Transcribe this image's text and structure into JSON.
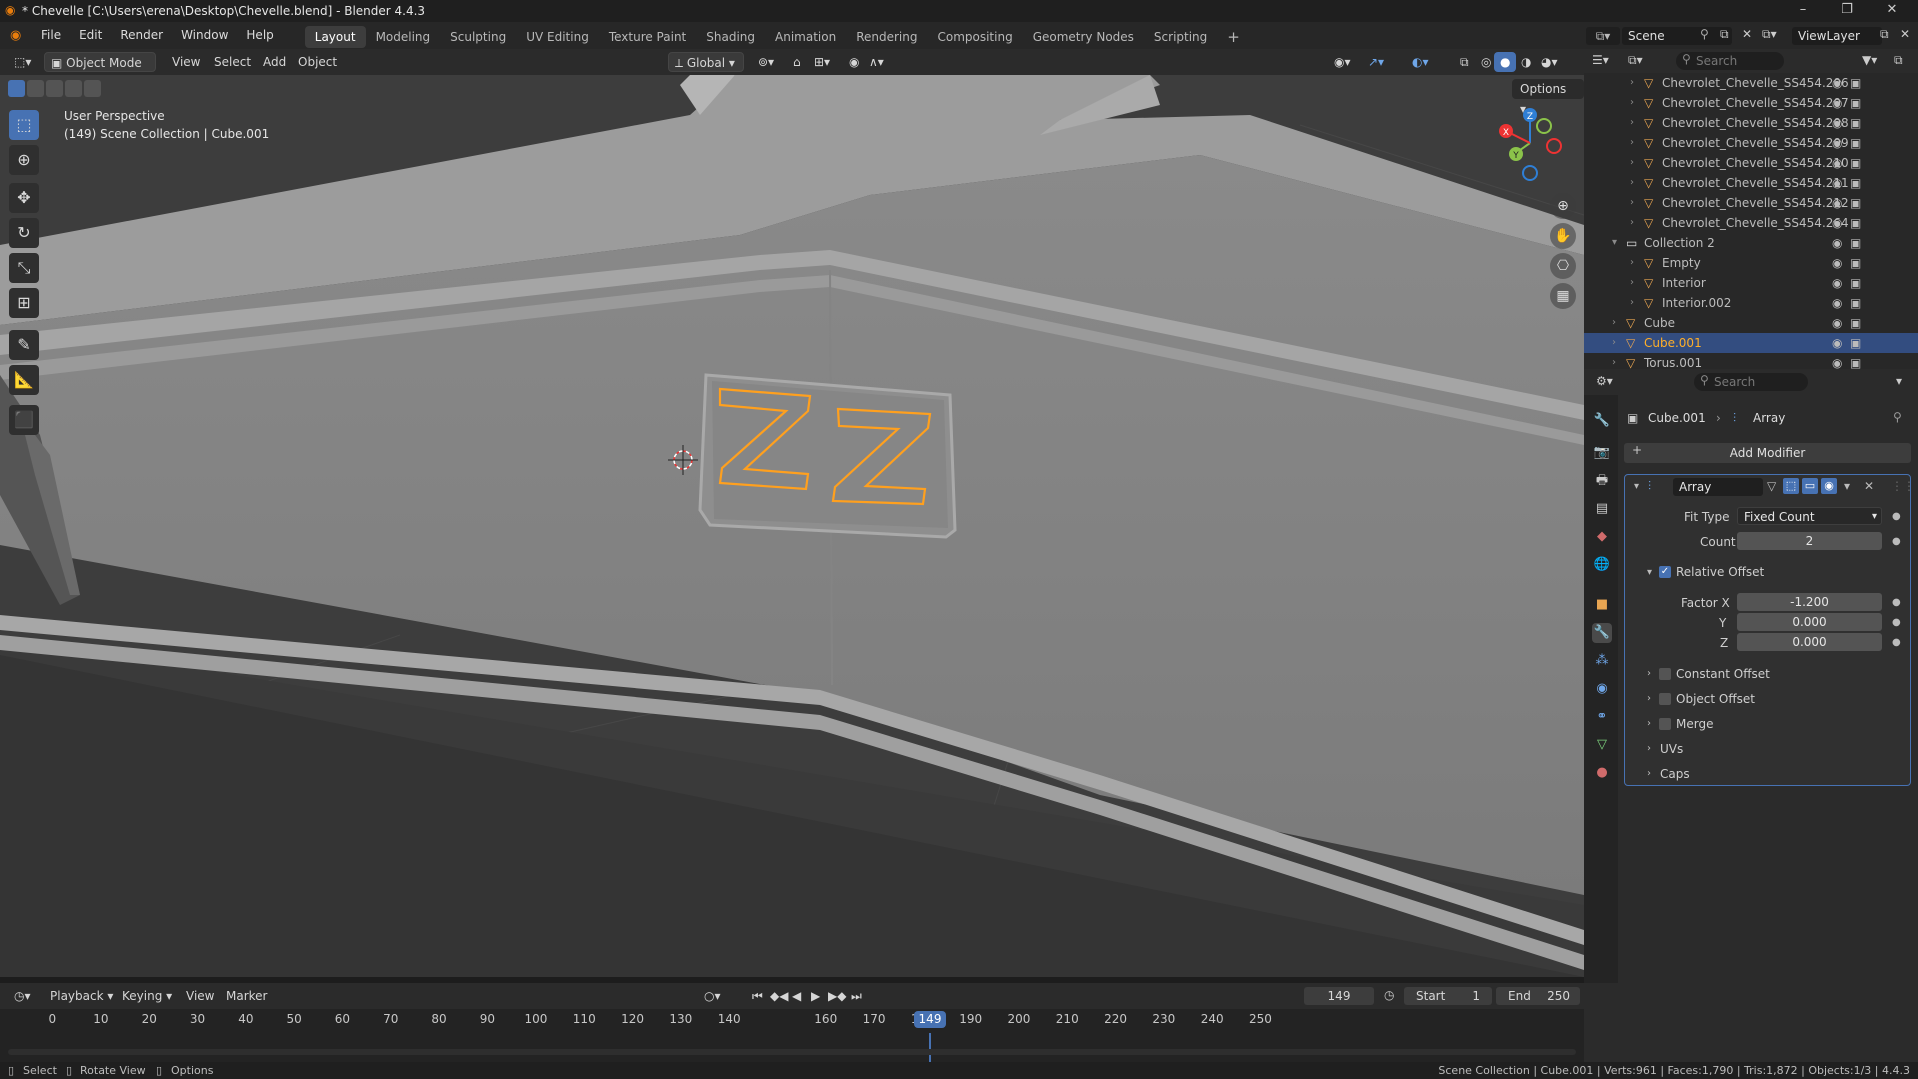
{
  "window": {
    "title": "* Chevelle [C:\\Users\\erena\\Desktop\\Chevelle.blend] - Blender 4.4.3"
  },
  "menu": {
    "file": "File",
    "edit": "Edit",
    "render": "Render",
    "window": "Window",
    "help": "Help"
  },
  "workspaces": [
    "Layout",
    "Modeling",
    "Sculpting",
    "UV Editing",
    "Texture Paint",
    "Shading",
    "Animation",
    "Rendering",
    "Compositing",
    "Geometry Nodes",
    "Scripting"
  ],
  "topright": {
    "scene": "Scene",
    "viewlayer": "ViewLayer"
  },
  "viewport_header": {
    "mode": "Object Mode",
    "view": "View",
    "select": "Select",
    "add": "Add",
    "object": "Object",
    "orientation": "Global",
    "options": "Options"
  },
  "viewport": {
    "perspective": "User Perspective",
    "collection": "(149) Scene Collection | Cube.001",
    "logo_text": "ZZ"
  },
  "gizmo": {
    "x": "X",
    "y": "Y",
    "z": "Z"
  },
  "outliner": {
    "search_placeholder": "Search",
    "rows": [
      {
        "name": "Chevrolet_Chevelle_SS454.206",
        "level": 2
      },
      {
        "name": "Chevrolet_Chevelle_SS454.207",
        "level": 2
      },
      {
        "name": "Chevrolet_Chevelle_SS454.208",
        "level": 2
      },
      {
        "name": "Chevrolet_Chevelle_SS454.209",
        "level": 2
      },
      {
        "name": "Chevrolet_Chevelle_SS454.210",
        "level": 2
      },
      {
        "name": "Chevrolet_Chevelle_SS454.211",
        "level": 2
      },
      {
        "name": "Chevrolet_Chevelle_SS454.212",
        "level": 2
      },
      {
        "name": "Chevrolet_Chevelle_SS454.264",
        "level": 2
      },
      {
        "name": "Collection 2",
        "level": 1
      },
      {
        "name": "Empty",
        "level": 2
      },
      {
        "name": "Interior",
        "level": 2
      },
      {
        "name": "Interior.002",
        "level": 2
      },
      {
        "name": "Cube",
        "level": 1
      },
      {
        "name": "Cube.001",
        "level": 1,
        "selected": true
      },
      {
        "name": "Torus.001",
        "level": 1
      }
    ]
  },
  "properties": {
    "search_placeholder": "Search",
    "breadcrumb_object": "Cube.001",
    "breadcrumb_modifier": "Array",
    "add_modifier": "Add Modifier",
    "modifier_name": "Array",
    "fit_type_label": "Fit Type",
    "fit_type_value": "Fixed Count",
    "count_label": "Count",
    "count_value": "2",
    "relative_offset_label": "Relative Offset",
    "factor_x_label": "Factor X",
    "factor_x_value": "-1.200",
    "factor_y_label": "Y",
    "factor_y_value": "0.000",
    "factor_z_label": "Z",
    "factor_z_value": "0.000",
    "constant_offset": "Constant Offset",
    "object_offset": "Object Offset",
    "merge": "Merge",
    "uvs": "UVs",
    "caps": "Caps"
  },
  "timeline": {
    "playback": "Playback",
    "keying": "Keying",
    "view": "View",
    "marker": "Marker",
    "current_frame": "149",
    "start_label": "Start",
    "start_value": "1",
    "end_label": "End",
    "end_value": "250",
    "ticks": [
      "0",
      "10",
      "20",
      "30",
      "40",
      "50",
      "60",
      "70",
      "80",
      "90",
      "100",
      "110",
      "120",
      "130",
      "140",
      "160",
      "170",
      "180",
      "190",
      "200",
      "210",
      "220",
      "230",
      "240",
      "250"
    ],
    "playhead": "149"
  },
  "status": {
    "select": "Select",
    "rotate": "Rotate View",
    "options": "Options",
    "stats": "Scene Collection | Cube.001 | Verts:961 | Faces:1,790 | Tris:1,872 | Objects:1/3 | 4.4.3"
  },
  "colors": {
    "accent": "#4772b3",
    "selection_orange": "#ffaf29",
    "object_icon": "#e8a552"
  }
}
